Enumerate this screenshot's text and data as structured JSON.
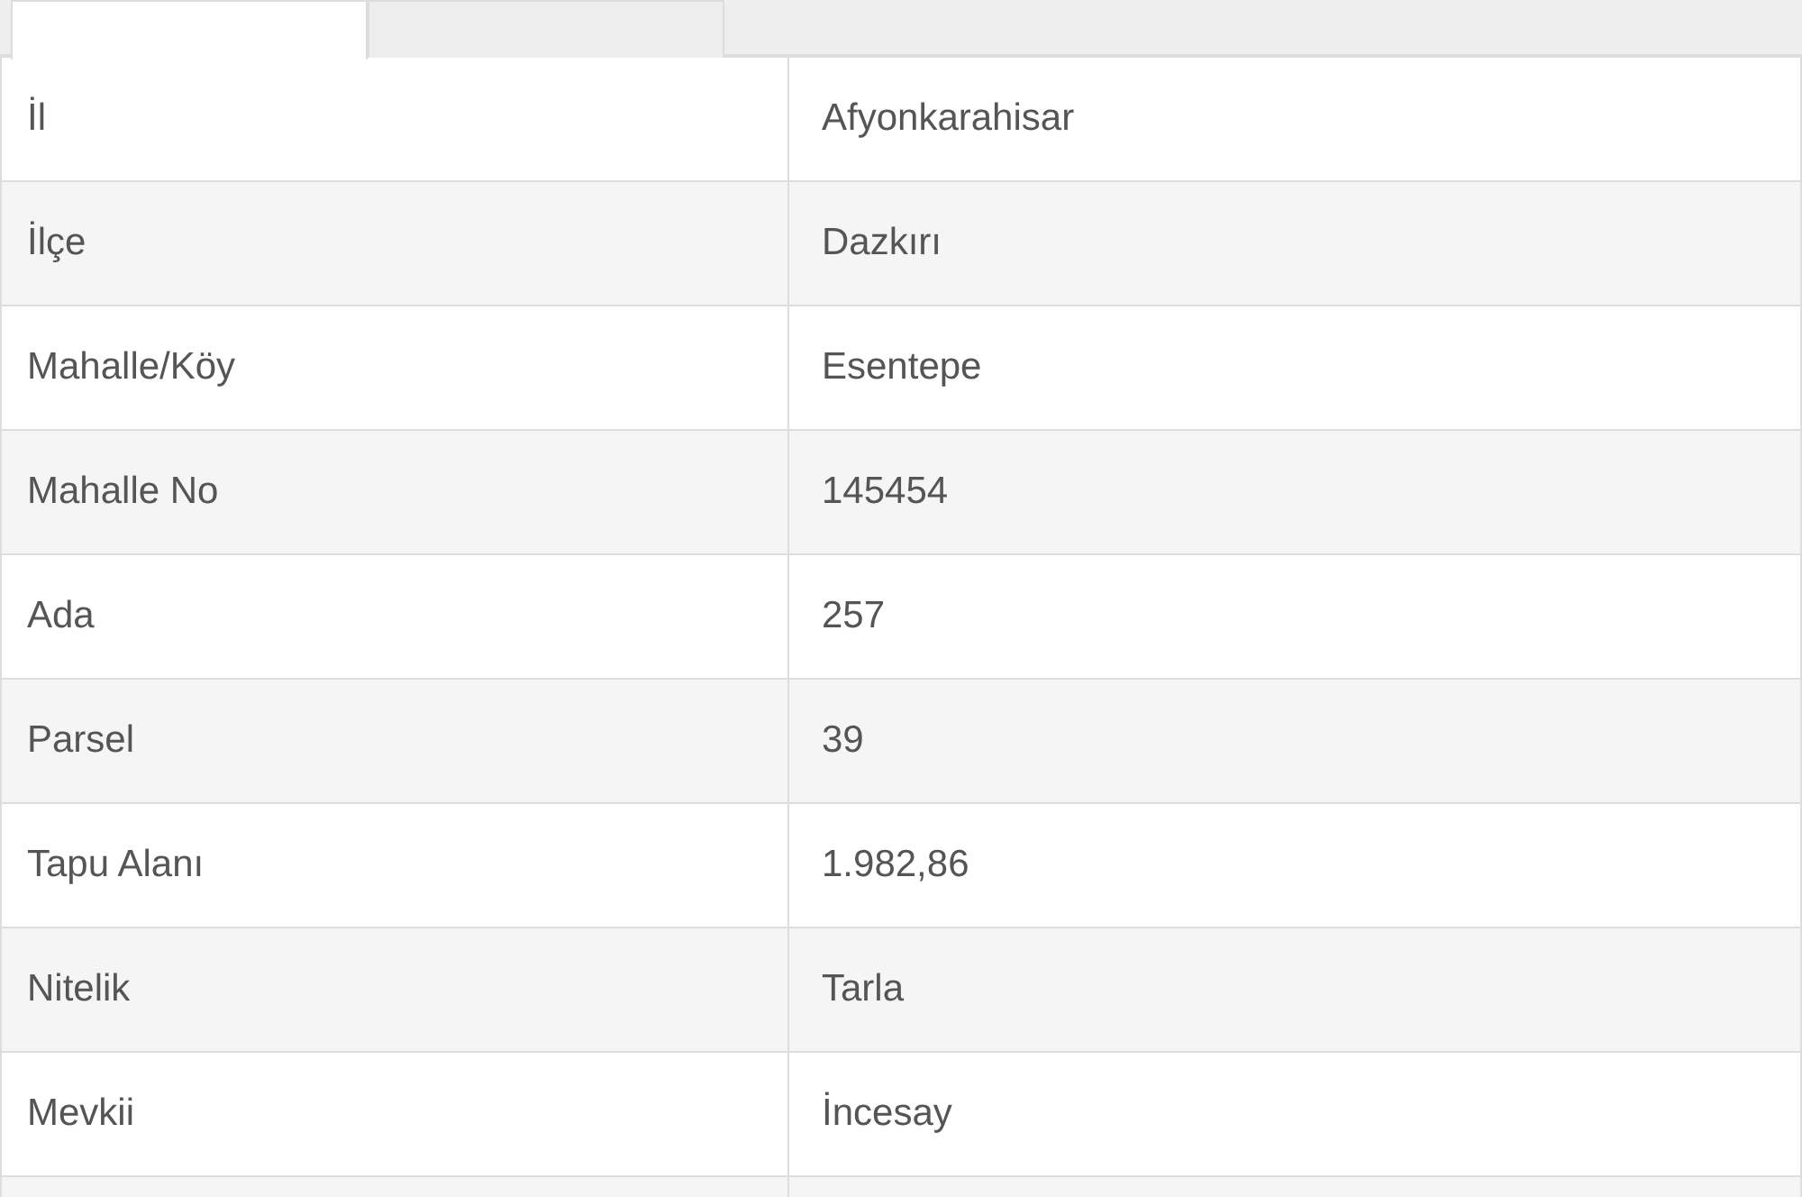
{
  "tabs": [
    {
      "selected": true
    },
    {
      "selected": false
    }
  ],
  "table": {
    "rows": [
      {
        "label": "İl",
        "value": "Afyonkarahisar"
      },
      {
        "label": "İlçe",
        "value": "Dazkırı"
      },
      {
        "label": "Mahalle/Köy",
        "value": "Esentepe"
      },
      {
        "label": "Mahalle No",
        "value": "145454"
      },
      {
        "label": "Ada",
        "value": "257"
      },
      {
        "label": "Parsel",
        "value": "39"
      },
      {
        "label": "Tapu Alanı",
        "value": "1.982,86"
      },
      {
        "label": "Nitelik",
        "value": "Tarla"
      },
      {
        "label": "Mevkii",
        "value": "İncesay"
      }
    ]
  }
}
